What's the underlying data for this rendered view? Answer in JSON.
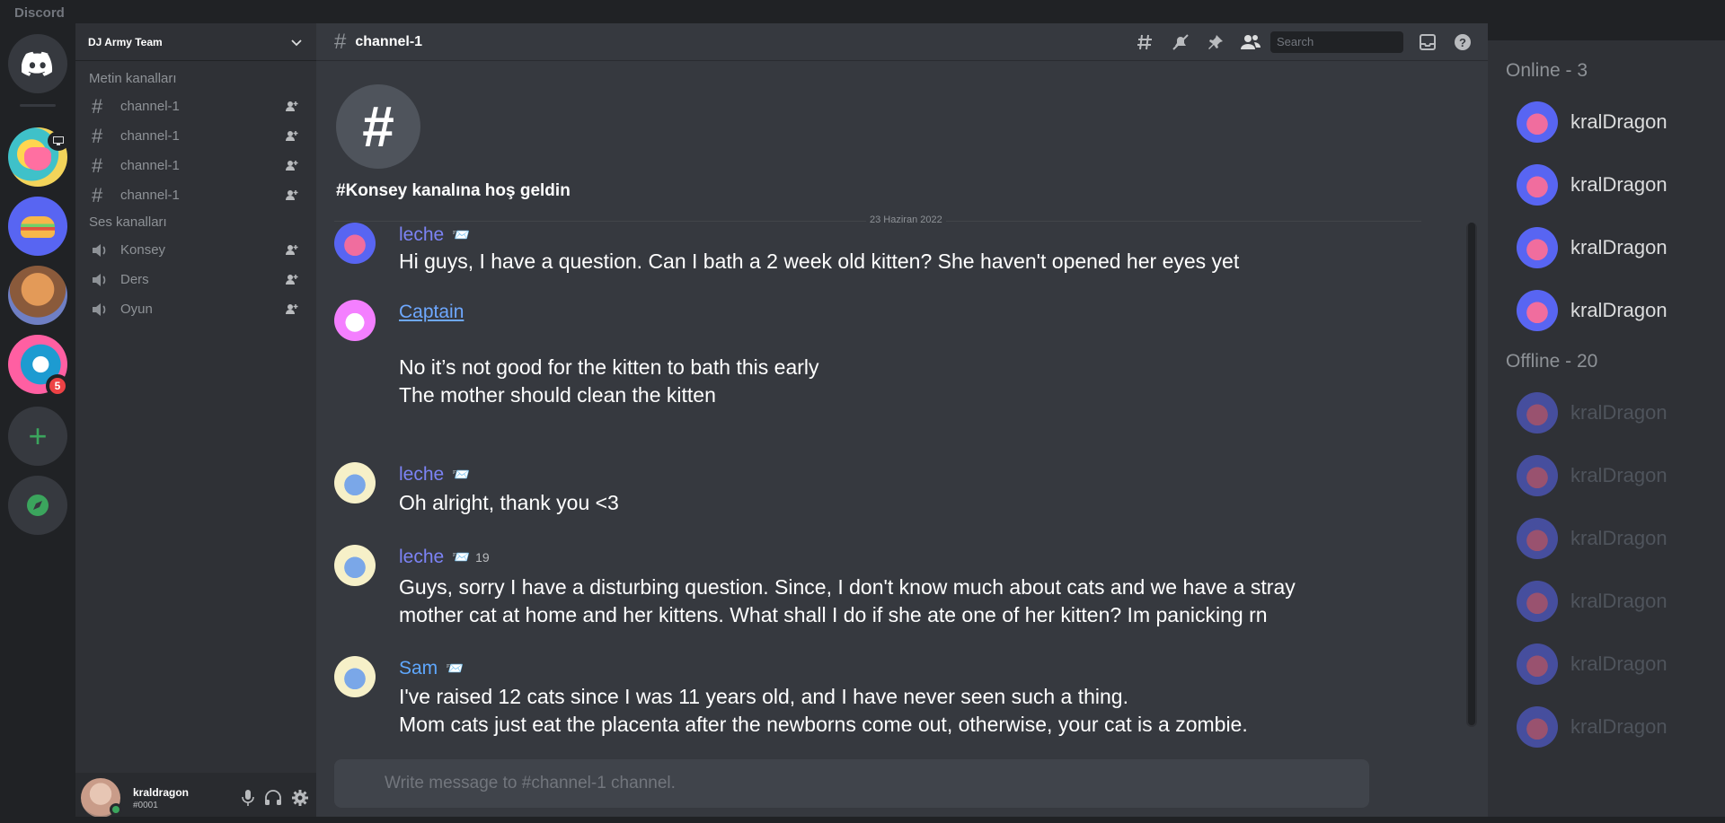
{
  "app": {
    "title": "Discord"
  },
  "servers": {
    "badge_count": "5",
    "items": [
      {
        "icon": "discord-home-icon"
      },
      {
        "icon": "server-icon-mascot"
      },
      {
        "icon": "server-icon-burger"
      },
      {
        "icon": "server-icon-rock"
      },
      {
        "icon": "server-icon-car"
      }
    ],
    "add_icon": "+",
    "explore_icon": "compass-icon"
  },
  "guild": {
    "name": "DJ Army Team",
    "text_category": "Metin kanalları",
    "text_channels": [
      "channel-1",
      "channel-1",
      "channel-1",
      "channel-1"
    ],
    "voice_category": "Ses kanalları",
    "voice_channels": [
      "Konsey",
      "Ders",
      "Oyun"
    ]
  },
  "user": {
    "name": "kraldragon",
    "tag": "#0001"
  },
  "channel": {
    "name": "channel-1",
    "welcome_title": "#Konsey kanalına hoş geldin",
    "date_divider": "23 Haziran 2022",
    "search_placeholder": "Search",
    "composer_placeholder": "Write message to #channel-1 channel."
  },
  "messages": [
    {
      "author": "leche",
      "emoji": "📨",
      "stamp": "",
      "lines": [
        "Hi guys, I have a question. Can I bath a 2 week old kitten? She haven't opened her eyes yet"
      ]
    },
    {
      "author": "Captain",
      "emoji": "",
      "stamp": "",
      "lines": [
        "No it’s not good for the kitten to bath this early",
        "The mother should clean the kitten"
      ]
    },
    {
      "author": "leche",
      "emoji": "📨",
      "stamp": "",
      "lines": [
        "Oh alright, thank you <3"
      ]
    },
    {
      "author": "leche",
      "emoji": "📨",
      "stamp": "19",
      "lines": [
        "Guys, sorry I have a disturbing question. Since, I don't know much about cats and we have a stray",
        "mother cat at home and her kittens. What shall I do if she ate one of her kitten? Im panicking rn"
      ]
    },
    {
      "author": "Sam",
      "emoji": "📨",
      "stamp": "",
      "lines": [
        "I've raised 12 cats since I was 11 years old, and I have never seen such a thing.",
        "Mom cats just eat the placenta after the newborns come out, otherwise, your cat is a zombie."
      ]
    }
  ],
  "members": {
    "online_label": "Online - 3",
    "offline_label": "Offline - 20",
    "online": [
      "kralDragon",
      "kralDragon",
      "kralDragon",
      "kralDragon"
    ],
    "offline": [
      "kralDragon",
      "kralDragon",
      "kralDragon",
      "kralDragon",
      "kralDragon",
      "kralDragon"
    ]
  }
}
